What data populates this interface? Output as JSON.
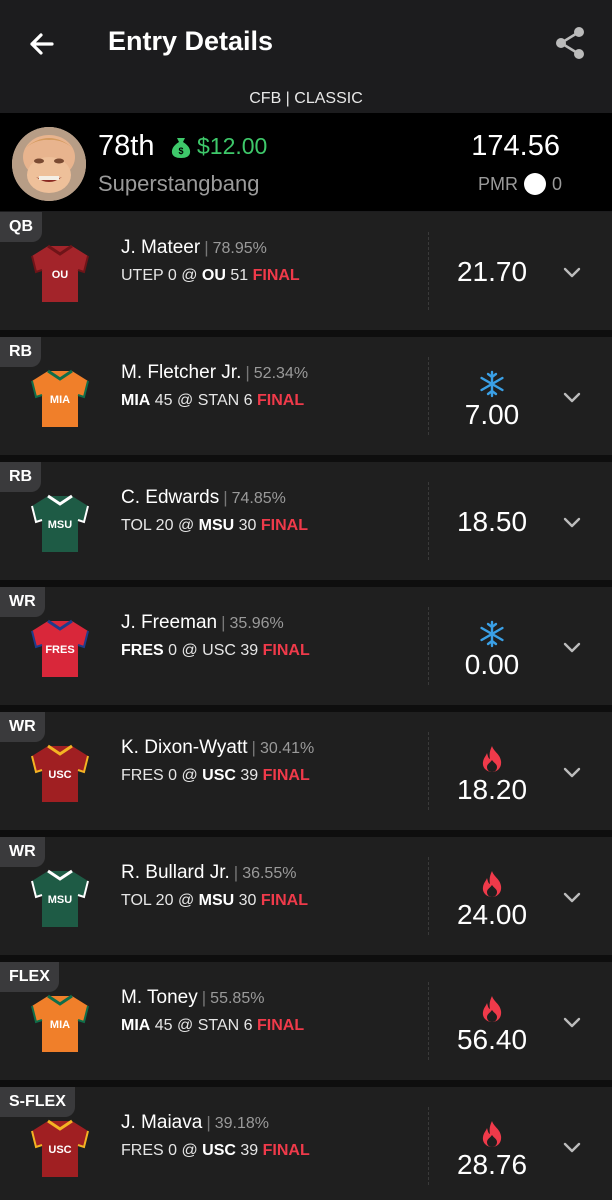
{
  "header": {
    "title": "Entry Details"
  },
  "contest_type": "CFB | CLASSIC",
  "summary": {
    "rank": "78th",
    "winnings": "$12.00",
    "username": "Superstangbang",
    "total_points": "174.56",
    "pmr_label": "PMR",
    "pmr_value": "0"
  },
  "colors": {
    "accent_green": "#3ec86a",
    "final_red": "#ef3a4a",
    "hot": "#ef3a4a",
    "cold": "#3aa0e6"
  },
  "players": [
    {
      "pos": "QB",
      "name": "J. Mateer",
      "own": "78.95%",
      "away": "UTEP 0",
      "home": "OU 51",
      "bold": "home",
      "final": "FINAL",
      "points": "21.70",
      "status": "none",
      "jersey_color": "#a3242a",
      "jersey_trim": "#6f1418",
      "jersey_text": "OU"
    },
    {
      "pos": "RB",
      "name": "M. Fletcher Jr.",
      "own": "52.34%",
      "away": "MIA 45",
      "home": "STAN 6",
      "bold": "away",
      "final": "FINAL",
      "points": "7.00",
      "status": "cold",
      "jersey_color": "#f07f2a",
      "jersey_trim": "#0f6e4a",
      "jersey_text": "MIA"
    },
    {
      "pos": "RB",
      "name": "C. Edwards",
      "own": "74.85%",
      "away": "TOL 20",
      "home": "MSU 30",
      "bold": "home",
      "final": "FINAL",
      "points": "18.50",
      "status": "none",
      "jersey_color": "#1e5b45",
      "jersey_trim": "#ffffff",
      "jersey_text": "MSU"
    },
    {
      "pos": "WR",
      "name": "J. Freeman",
      "own": "35.96%",
      "away": "FRES 0",
      "home": "USC 39",
      "bold": "away",
      "final": "FINAL",
      "points": "0.00",
      "status": "cold",
      "jersey_color": "#d9273a",
      "jersey_trim": "#1d3c8c",
      "jersey_text": "FRES"
    },
    {
      "pos": "WR",
      "name": "K. Dixon-Wyatt",
      "own": "30.41%",
      "away": "FRES 0",
      "home": "USC 39",
      "bold": "home",
      "final": "FINAL",
      "points": "18.20",
      "status": "hot",
      "jersey_color": "#a01f22",
      "jersey_trim": "#f4b323",
      "jersey_text": "USC"
    },
    {
      "pos": "WR",
      "name": "R. Bullard Jr.",
      "own": "36.55%",
      "away": "TOL 20",
      "home": "MSU 30",
      "bold": "home",
      "final": "FINAL",
      "points": "24.00",
      "status": "hot",
      "jersey_color": "#1e5b45",
      "jersey_trim": "#ffffff",
      "jersey_text": "MSU"
    },
    {
      "pos": "FLEX",
      "name": "M. Toney",
      "own": "55.85%",
      "away": "MIA 45",
      "home": "STAN 6",
      "bold": "away",
      "final": "FINAL",
      "points": "56.40",
      "status": "hot",
      "jersey_color": "#f07f2a",
      "jersey_trim": "#0f6e4a",
      "jersey_text": "MIA"
    },
    {
      "pos": "S-FLEX",
      "name": "J. Maiava",
      "own": "39.18%",
      "away": "FRES 0",
      "home": "USC 39",
      "bold": "home",
      "final": "FINAL",
      "points": "28.76",
      "status": "hot",
      "jersey_color": "#a01f22",
      "jersey_trim": "#f4b323",
      "jersey_text": "USC"
    }
  ]
}
